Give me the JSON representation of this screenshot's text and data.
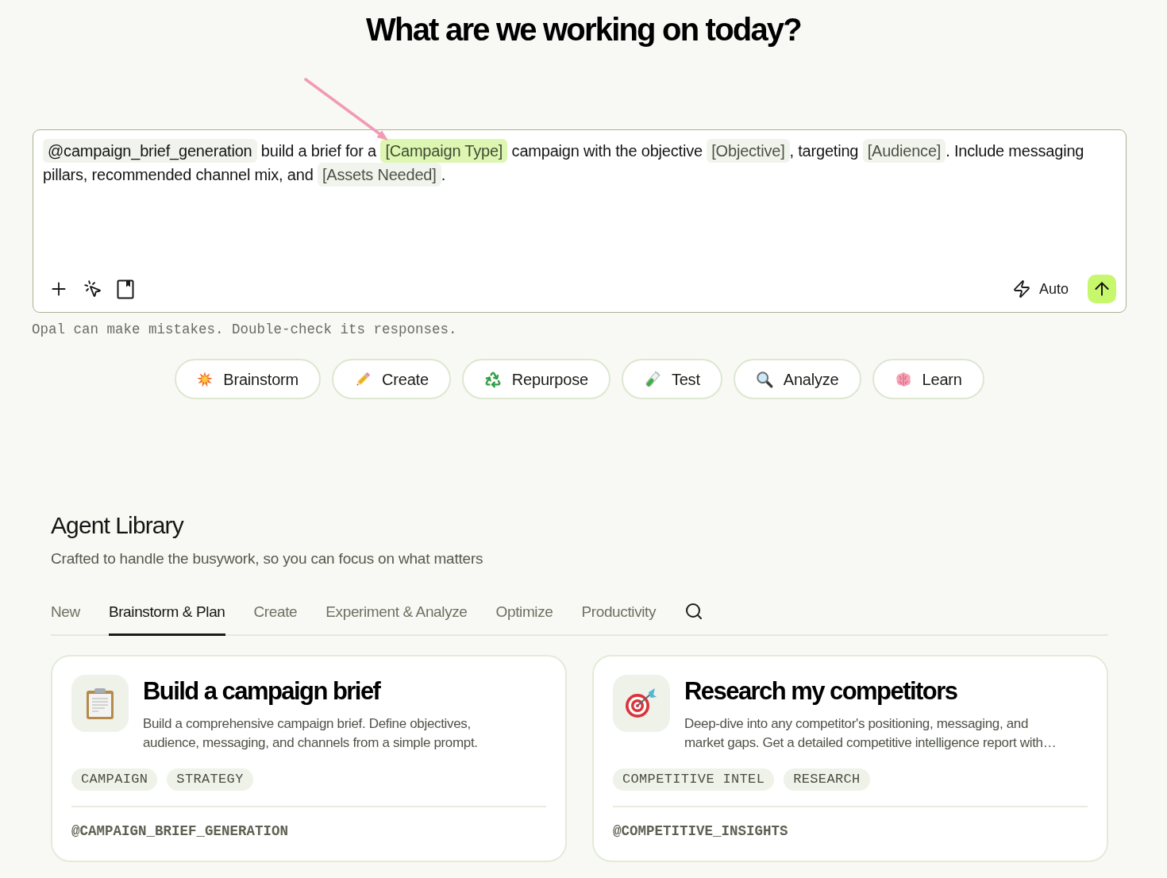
{
  "heading": "What are we working on today?",
  "prompt": {
    "segments": [
      {
        "kind": "mention",
        "text": "@campaign_brief_generation"
      },
      {
        "kind": "text",
        "text": " build a brief for a "
      },
      {
        "kind": "variable",
        "text": "[Campaign Type]",
        "selected": true
      },
      {
        "kind": "text",
        "text": " campaign with the objective "
      },
      {
        "kind": "variable",
        "text": "[Objective]",
        "selected": false
      },
      {
        "kind": "text",
        "text": ", targeting "
      },
      {
        "kind": "variable",
        "text": "[Audience]",
        "selected": false
      },
      {
        "kind": "text",
        "text": ". Include messaging pillars, recommended channel mix, and "
      },
      {
        "kind": "variable",
        "text": "[Assets Needed]",
        "selected": false
      },
      {
        "kind": "text",
        "text": "."
      }
    ],
    "mode": "Auto"
  },
  "disclaimer": "Opal can make mistakes. Double-check its responses.",
  "quick_actions": [
    {
      "label": "Brainstorm"
    },
    {
      "label": "Create"
    },
    {
      "label": "Repurpose"
    },
    {
      "label": "Test"
    },
    {
      "label": "Analyze"
    },
    {
      "label": "Learn"
    }
  ],
  "library": {
    "title": "Agent Library",
    "subtitle": "Crafted to handle the busywork, so you can focus on what matters",
    "tabs": [
      {
        "label": "New",
        "selected": false
      },
      {
        "label": "Brainstorm & Plan",
        "selected": true
      },
      {
        "label": "Create",
        "selected": false
      },
      {
        "label": "Experiment & Analyze",
        "selected": false
      },
      {
        "label": "Optimize",
        "selected": false
      },
      {
        "label": "Productivity",
        "selected": false
      }
    ],
    "cards": [
      {
        "title": "Build a campaign brief",
        "description": "Build a comprehensive campaign brief. Define objectives, audience, messaging, and channels from a simple prompt.",
        "tags": [
          "CAMPAIGN",
          "STRATEGY"
        ],
        "handle": "@CAMPAIGN_BRIEF_GENERATION"
      },
      {
        "title": "Research my competitors",
        "description": "Deep-dive into any competitor's positioning, messaging, and market gaps. Get a detailed competitive intelligence report with…",
        "tags": [
          "COMPETITIVE INTEL",
          "RESEARCH"
        ],
        "handle": "@COMPETITIVE_INSIGHTS"
      }
    ]
  }
}
